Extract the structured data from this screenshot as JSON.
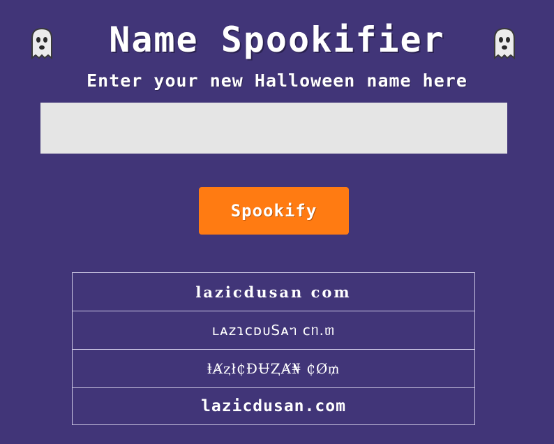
{
  "header": {
    "title": "Name Spookifier",
    "subtitle": "Enter your new Halloween name here"
  },
  "form": {
    "input_value": "",
    "input_placeholder": "",
    "button_label": "Spookify"
  },
  "results": [
    "lazicdusan  com",
    "ʟᴀᴢɿᴄᴅᴜSᴀᥐ ᴄᥒ.ᥖ",
    "ⱡȺⱬł₵ĐɄⱫȺ₦ ₵Ø₥",
    "lazicdusan.com"
  ],
  "colors": {
    "background": "#413578",
    "button": "#ff7b12",
    "input": "#e5e5e5",
    "table_border": "#cfcae6"
  },
  "icons": {
    "left": "ghost-icon",
    "right": "ghost-icon"
  }
}
